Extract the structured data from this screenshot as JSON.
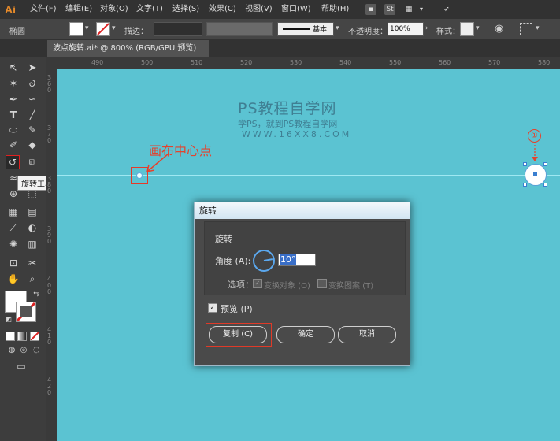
{
  "menubar": {
    "logo": "Ai",
    "items": [
      "文件(F)",
      "编辑(E)",
      "对象(O)",
      "文字(T)",
      "选择(S)",
      "效果(C)",
      "视图(V)",
      "窗口(W)",
      "帮助(H)"
    ],
    "icons": [
      "bridge-icon",
      "stock-icon",
      "arrange-icon",
      "rocket-icon"
    ],
    "stock_label": "St"
  },
  "controlbar": {
    "selection_label": "椭圆",
    "stroke_label": "描边：",
    "stroke_profile": "基本",
    "opacity_label": "不透明度：",
    "opacity_value": "100%",
    "style_label": "样式："
  },
  "tab": {
    "title": "波点旋转.ai* @ 800% (RGB/GPU 预览)",
    "close": "×"
  },
  "tools": {
    "tooltip": "旋转工具 (R)"
  },
  "rulers": {
    "top": [
      "490",
      "500",
      "510",
      "520",
      "530",
      "540",
      "550",
      "560",
      "570",
      "580"
    ],
    "left": [
      "3 6 0",
      "3 7 0",
      "3 8 0",
      "3 9 0",
      "4 0 0",
      "4 1 0",
      "4 2 0"
    ]
  },
  "canvas": {
    "watermark_title": "PS教程自学网",
    "watermark_subtitle": "学PS，就到PS教程自学网",
    "watermark_url": "WWW.16XX8.COM",
    "center_label": "画布中心点",
    "step_number": "①"
  },
  "dialog": {
    "title": "旋转",
    "section": "旋转",
    "angle_label": "角度 (A):",
    "angle_value": "10°",
    "options_label": "选项：",
    "transform_objects": "变换对象 (O)",
    "transform_patterns": "变换图案 (T)",
    "preview_label": "预览 (P)",
    "copy_button": "复制 (C)",
    "ok_button": "确定",
    "cancel_button": "取消"
  },
  "colors": {
    "canvas": "#5bc3d2",
    "annotation_red": "#e5422c",
    "dial_blue": "#5ba8ee"
  }
}
